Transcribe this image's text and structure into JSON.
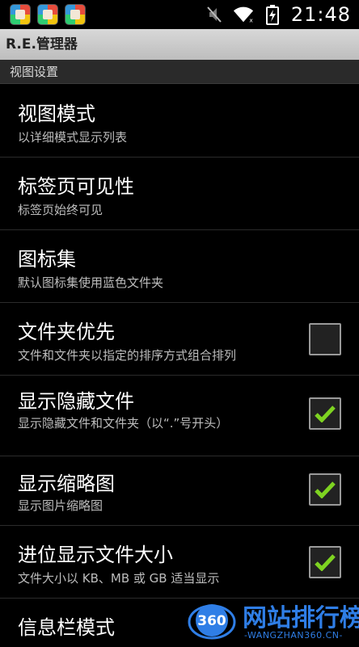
{
  "statusbar": {
    "time": "21:48",
    "icons": [
      "app-notification-icon",
      "app-notification-icon",
      "app-notification-icon",
      "mute-icon",
      "wifi-icon",
      "battery-charging-icon"
    ]
  },
  "app": {
    "title": "R.E.管理器"
  },
  "section": {
    "label": "视图设置"
  },
  "items": [
    {
      "title": "视图模式",
      "subtitle": "以详细模式显示列表",
      "checkbox": null
    },
    {
      "title": "标签页可见性",
      "subtitle": "标签页始终可见",
      "checkbox": null
    },
    {
      "title": "图标集",
      "subtitle": "默认图标集使用蓝色文件夹",
      "checkbox": null
    },
    {
      "title": "文件夹优先",
      "subtitle": "文件和文件夹以指定的排序方式组合排列",
      "checkbox": false
    },
    {
      "title": "显示隐藏文件",
      "subtitle": "显示隐藏文件和文件夹（以“.”号开头）",
      "checkbox": true
    },
    {
      "title": "显示缩略图",
      "subtitle": "显示图片缩略图",
      "checkbox": true
    },
    {
      "title": "进位显示文件大小",
      "subtitle": "文件大小以 KB、MB 或 GB 适当显示",
      "checkbox": true
    },
    {
      "title": "信息栏模式",
      "subtitle": "",
      "checkbox": null
    }
  ],
  "watermark": {
    "logo_text": "360",
    "title": "网站排行榜",
    "subtitle": "-WANGZHAN360.CN-"
  },
  "colors": {
    "check": "#7ed321",
    "watermark": "#2f7ee6"
  }
}
